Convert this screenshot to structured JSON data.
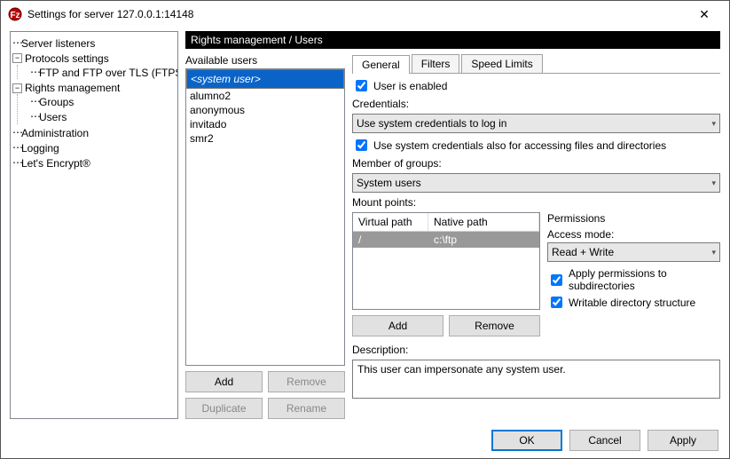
{
  "window": {
    "title": "Settings for server 127.0.0.1:14148"
  },
  "nav": {
    "server_listeners": "Server listeners",
    "protocols": "Protocols settings",
    "ftp": "FTP and FTP over TLS (FTPS)",
    "rights": "Rights management",
    "groups": "Groups",
    "users": "Users",
    "admin": "Administration",
    "logging": "Logging",
    "lets": "Let's Encrypt®"
  },
  "header": "Rights management / Users",
  "users_label": "Available users",
  "users": [
    "<system user>",
    "alumno2",
    "anonymous",
    "invitado",
    "smr2"
  ],
  "user_buttons": {
    "add": "Add",
    "remove": "Remove",
    "duplicate": "Duplicate",
    "rename": "Rename"
  },
  "tabs": {
    "general": "General",
    "filters": "Filters",
    "speed": "Speed Limits"
  },
  "general": {
    "enabled_label": "User is enabled",
    "credentials_label": "Credentials:",
    "credentials_value": "Use system credentials to log in",
    "sys_access_label": "Use system credentials also for accessing files and directories",
    "member_label": "Member of groups:",
    "member_value": "System users",
    "mount_label": "Mount points:",
    "mount_headers": {
      "vpath": "Virtual path",
      "npath": "Native path"
    },
    "mount_row": {
      "vpath": "/",
      "npath": "c:\\ftp"
    },
    "mount_add": "Add",
    "mount_remove": "Remove",
    "perm_label": "Permissions",
    "access_label": "Access mode:",
    "access_value": "Read + Write",
    "apply_sub_label": "Apply permissions to subdirectories",
    "writable_label": "Writable directory structure",
    "desc_label": "Description:",
    "desc_value": "This user can impersonate any system user."
  },
  "footer": {
    "ok": "OK",
    "cancel": "Cancel",
    "apply": "Apply"
  }
}
